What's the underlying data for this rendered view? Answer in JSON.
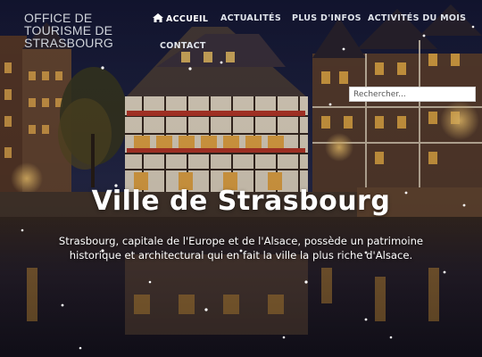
{
  "logo": {
    "line1": "OFFICE DE",
    "line2": "TOURISME DE",
    "line3": "STRASBOURG"
  },
  "nav": {
    "items": [
      {
        "label": "ACCUEIL",
        "icon": "home-icon",
        "active": true
      },
      {
        "label": "ACTUALITÉS"
      },
      {
        "label": "PLUS D'INFOS"
      },
      {
        "label": "ACTIVITÉS DU MOIS"
      },
      {
        "label": "CONTACT"
      }
    ]
  },
  "search": {
    "placeholder": "Rechercher..."
  },
  "hero": {
    "title": "Ville de Strasbourg",
    "text": "Strasbourg, capitale de l'Europe et de l'Alsace, possède un patrimoine historique et architectural qui en fait la ville la plus riche d'Alsace."
  },
  "colors": {
    "sky": "#1c2040",
    "water": "#2a2230",
    "lights": "#f2b54a",
    "beam": "#3a2a28"
  }
}
